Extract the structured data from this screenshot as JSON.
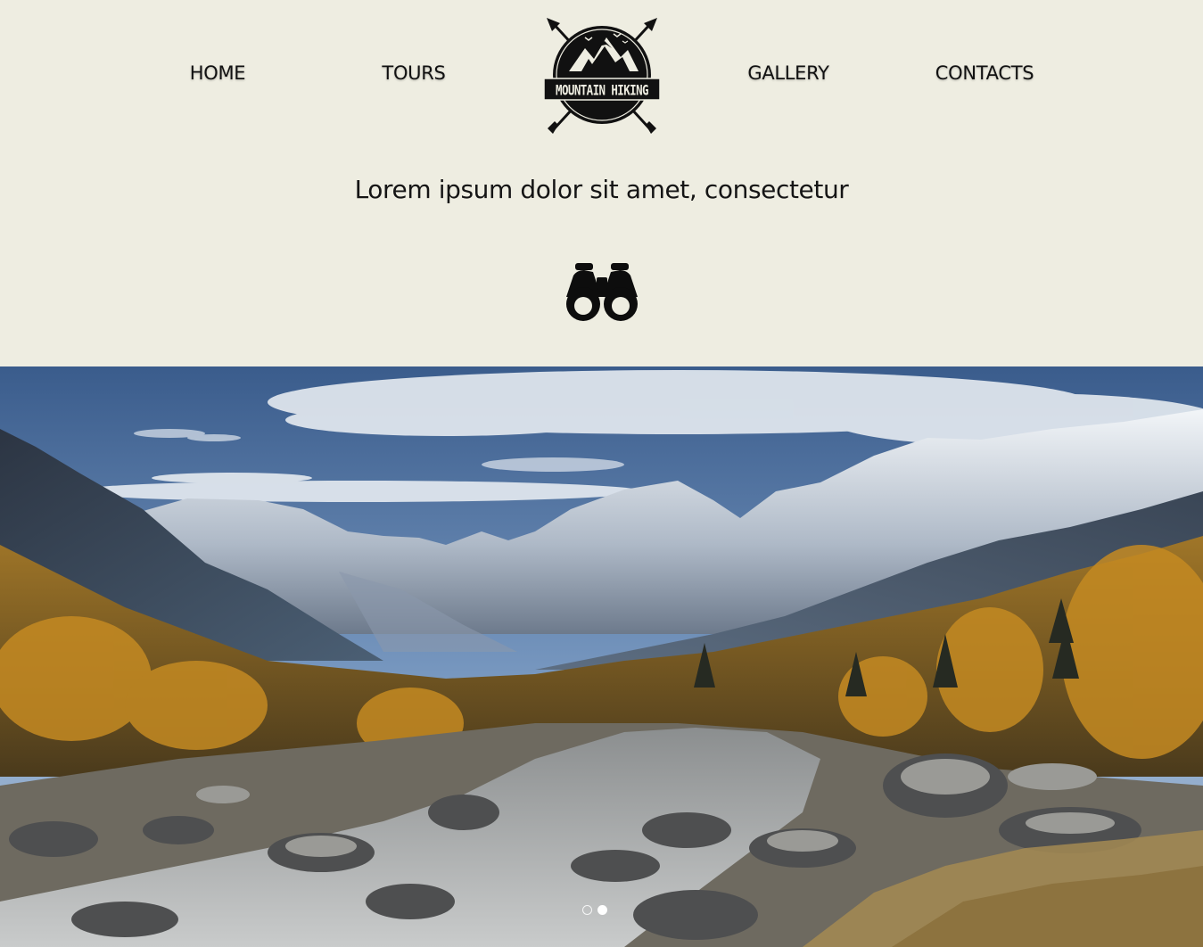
{
  "nav": {
    "items": [
      {
        "label": "HOME"
      },
      {
        "label": "TOURS"
      },
      {
        "label": "GALLERY"
      },
      {
        "label": "CONTACTS"
      }
    ]
  },
  "logo": {
    "text": "MOUNTAIN HIKING",
    "icon": "crossed-arrows-mountain-badge"
  },
  "hero_text": {
    "tagline": "Lorem ipsum dolor sit amet, consectetur",
    "icon": "binoculars-icon"
  },
  "slider": {
    "slide_count": 2,
    "active_slide": 2
  },
  "colors": {
    "header_bg": "#eeede1",
    "text": "#111111",
    "dot_active": "#ffffff"
  }
}
